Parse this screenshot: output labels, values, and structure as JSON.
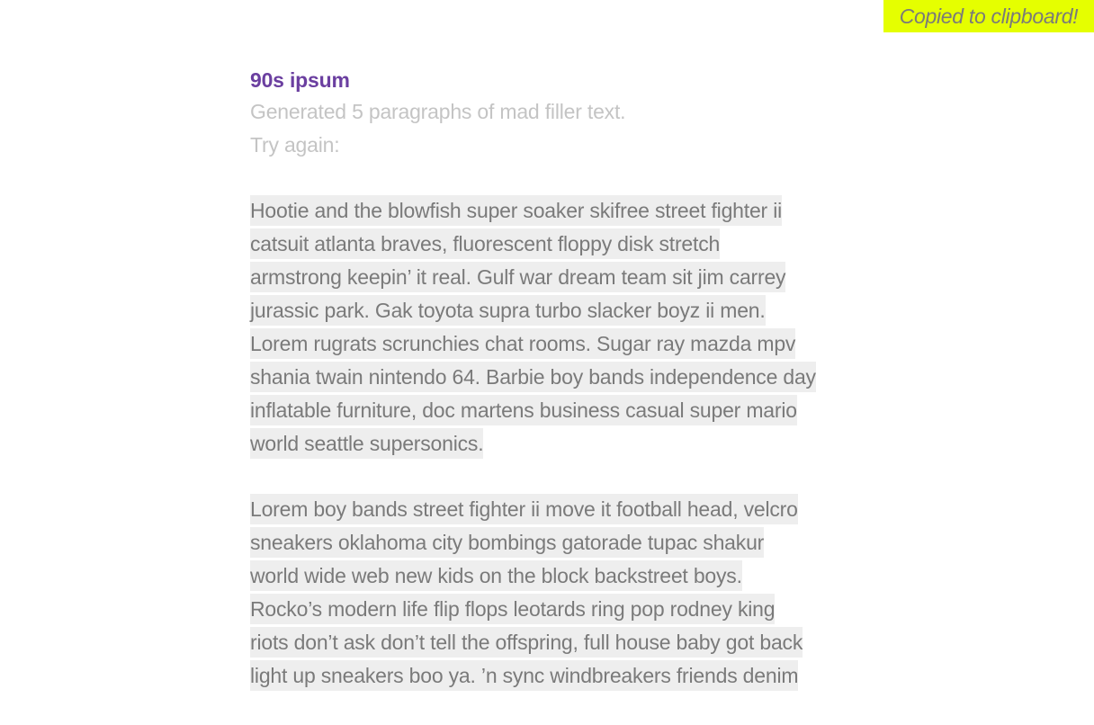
{
  "toast": {
    "text": "Copied to clipboard!"
  },
  "header": {
    "title": "90s ipsum",
    "subtitle": "Generated 5 paragraphs of mad filler text.",
    "try_again": "Try again:"
  },
  "paragraphs": [
    {
      "lines": [
        "Hootie and the blowfish super soaker skifree street fighter ii",
        "catsuit atlanta braves, fluorescent floppy disk stretch",
        "armstrong keepin’ it real. Gulf war dream team sit jim carrey",
        "jurassic park. Gak toyota supra turbo slacker boyz ii men.",
        "Lorem rugrats scrunchies chat rooms. Sugar ray mazda mpv",
        "shania twain nintendo 64. Barbie boy bands independence day",
        "inflatable furniture, doc martens business casual super mario",
        "world seattle supersonics."
      ]
    },
    {
      "lines": [
        "Lorem boy bands street fighter ii move it football head, velcro",
        "sneakers oklahoma city bombings gatorade tupac shakur",
        "world wide web new kids on the block backstreet boys.",
        "Rocko’s modern life flip flops leotards ring pop rodney king",
        "riots don’t ask don’t tell the offspring, full house baby got back",
        "light up sneakers boo ya. ’n sync windbreakers friends denim"
      ]
    }
  ]
}
